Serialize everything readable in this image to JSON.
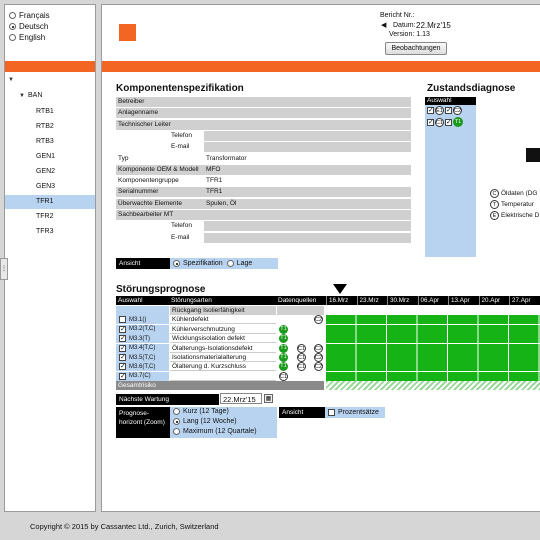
{
  "languages": [
    {
      "label": "Français",
      "selected": false
    },
    {
      "label": "Deutsch",
      "selected": true
    },
    {
      "label": "English",
      "selected": false
    }
  ],
  "tree": {
    "root": "BAN",
    "items": [
      "RTB1",
      "RTB2",
      "RTB3",
      "GEN1",
      "GEN2",
      "GEN3",
      "TFR1",
      "TFR2",
      "TFR3"
    ],
    "selected": "TFR1"
  },
  "report": {
    "number_label": "Bericht Nr.:",
    "date_label": "Datum:",
    "date_value": "22.Mrz'15",
    "version": "Version: 1.13",
    "observations_button": "Beobachtungen"
  },
  "spec": {
    "title": "Komponentenspezifikation",
    "rows": [
      {
        "label": "Betreiber",
        "value": ""
      },
      {
        "label": "Anlagenname",
        "value": ""
      },
      {
        "label": "Technischer Leiter",
        "value": ""
      },
      {
        "label": "Telefon",
        "value": ""
      },
      {
        "label": "E-mail",
        "value": ""
      },
      {
        "label": "Typ",
        "value": "Transformator"
      },
      {
        "label": "Komponente OEM & Modell",
        "value": "MFO"
      },
      {
        "label": "Komponentengruppe",
        "value": "TFR1"
      },
      {
        "label": "Serialnummer",
        "value": "TFR1"
      },
      {
        "label": "Überwachte Elemente",
        "value": "Spulen, Öl"
      },
      {
        "label": "Sachbearbeiter MT",
        "value": ""
      },
      {
        "label": "Telefon",
        "value": ""
      },
      {
        "label": "E-mail",
        "value": ""
      }
    ]
  },
  "view": {
    "label": "Ansicht",
    "options": [
      "Spezifikation",
      "Lage"
    ],
    "selected": "Spezifikation"
  },
  "diagnosis": {
    "title": "Zustandsdiagnose",
    "header": "Auswahl",
    "codes": [
      "E1",
      "C2",
      "C1",
      "T1"
    ],
    "legend": [
      "Öldaten (DG",
      "Temperatur",
      "Elektrische D"
    ],
    "legend_codes": [
      "C",
      "T",
      "E"
    ]
  },
  "forecast": {
    "title": "Störungsprognose",
    "col_select": "Auswahl",
    "col_types": "Störungsarten",
    "col_sources": "Datenquellen",
    "dates": [
      "16.Mrz",
      "23.Mrz",
      "30.Mrz",
      "06.Apr",
      "13.Apr",
      "20.Apr",
      "27.Apr"
    ],
    "rows": [
      {
        "code": "",
        "name": "Rückgang Isolierfähigkeit",
        "sources": [],
        "group": true
      },
      {
        "code": "M3.1()",
        "name": "Kühlerdefekt",
        "sources": [
          "C2"
        ],
        "checked": false
      },
      {
        "code": "M3.2(T,C)",
        "name": "Kühlerverschmutzung",
        "sources": [
          "T1"
        ],
        "checked": true
      },
      {
        "code": "M3.3(T)",
        "name": "Wicklungsisolation defekt",
        "sources": [
          "T1"
        ],
        "checked": true
      },
      {
        "code": "M3.4(T,C)",
        "name": "Ölalterungs-Isolationsdefekt",
        "sources": [
          "T1",
          "C1",
          "C2"
        ],
        "checked": true
      },
      {
        "code": "M3.5(T,C)",
        "name": "Isolationsmaterialalterung",
        "sources": [
          "T1",
          "C1",
          "C2"
        ],
        "checked": true
      },
      {
        "code": "M3.6(T,C)",
        "name": "Ölalterung d. Kurzschluss",
        "sources": [
          "T1",
          "C1",
          "C2"
        ],
        "checked": true
      },
      {
        "code": "M3.7(C)",
        "name": "",
        "sources": [
          "C1"
        ],
        "checked": true
      }
    ],
    "total_risk": "Gesamtrisiko",
    "next_service_label": "Nächste Wartung",
    "next_service_value": "22.Mrz'15",
    "horizon_label": "Prognose-horizont (Zoom)",
    "horizon_options": [
      "Kurz (12 Tage)",
      "Lang (12 Woche)",
      "Maximum (12 Quartale)"
    ],
    "horizon_selected": "Lang (12 Woche)",
    "view_label": "Ansicht",
    "percent_label": "Prozentsätze"
  },
  "footer": "Copyright © 2015 by Cassantec Ltd., Zurich, Switzerland",
  "colors": {
    "orange": "#f26522",
    "green": "#16b316",
    "lightblue": "#b8d3ef"
  }
}
